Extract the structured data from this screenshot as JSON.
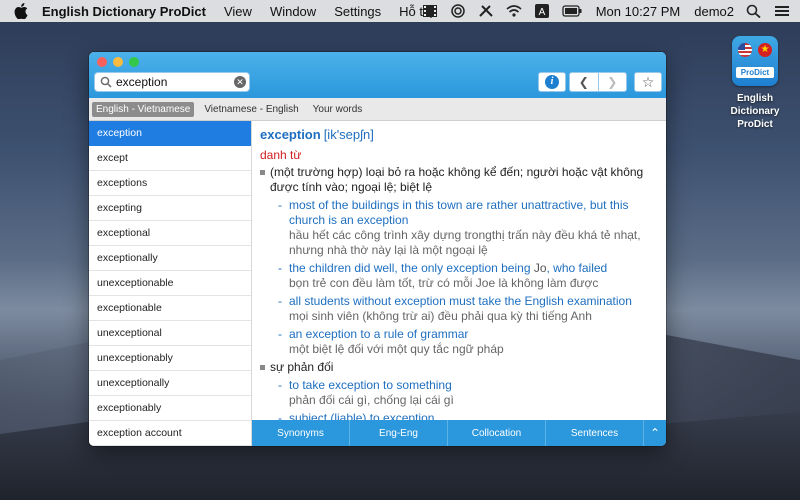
{
  "menubar": {
    "app_name": "English Dictionary ProDict",
    "items": [
      "View",
      "Window",
      "Settings",
      "Hỗ trợ"
    ],
    "clock": "Mon 10:27 PM",
    "user": "demo2"
  },
  "desktop_icon": {
    "badge_label": "ProDict",
    "title_line1": "English Dictionary",
    "title_line2": "ProDict"
  },
  "search": {
    "value": "exception"
  },
  "tabs": [
    {
      "label": "English - Vietnamese",
      "active": true
    },
    {
      "label": "Vietnamese - English",
      "active": false
    },
    {
      "label": "Your words",
      "active": false
    }
  ],
  "word_list": [
    "exception",
    "except",
    "exceptions",
    "excepting",
    "exceptional",
    "exceptionally",
    "unexceptionable",
    "exceptionable",
    "unexceptional",
    "unexceptionably",
    "unexceptionally",
    "exceptionably",
    "exception account"
  ],
  "entry": {
    "headword": "exception",
    "ipa": "[ik'sepʃn]",
    "pos": "danh từ",
    "sense1": "(một trường hợp) loại bỏ ra hoặc không kể đến; người hoặc vật không được tính vào; ngoại lệ; biệt lệ",
    "examples1": [
      {
        "en": "most of the buildings in this town are rather unattractive, but this church is an exception",
        "vi": "hầu hết các công trình xây dựng trongthị trấn này đều khá tẻ nhạt, nhưng nhà thờ này lại là một ngoại lệ"
      },
      {
        "en_a": "the children did well, the only exception being ",
        "en_b": "Jo",
        "en_c": ", who failed",
        "vi": "bọn trẻ con đều làm tốt, trừ có mỗi Joe là không làm được"
      },
      {
        "en": "all students without exception must take the English examination",
        "vi": "mọi sinh viên (không trừ ai) đều phải qua kỳ thi tiếng Anh"
      },
      {
        "en": "an exception to a rule of grammar",
        "vi": "một biệt lệ đối với một quy tắc ngữ pháp"
      }
    ],
    "sense2": "sự phản đối",
    "examples2": [
      {
        "en": "to take exception to something",
        "vi": "phản đối cái gì, chống lại cái gì"
      },
      {
        "en": "subject (liable) to exception",
        "vi": ""
      }
    ]
  },
  "bottom_tabs": [
    "Synonyms",
    "Eng-Eng",
    "Collocation",
    "Sentences"
  ],
  "colors": {
    "accent": "#2b97dc",
    "selection": "#1f7ce0",
    "pos_red": "#d21c1c"
  }
}
